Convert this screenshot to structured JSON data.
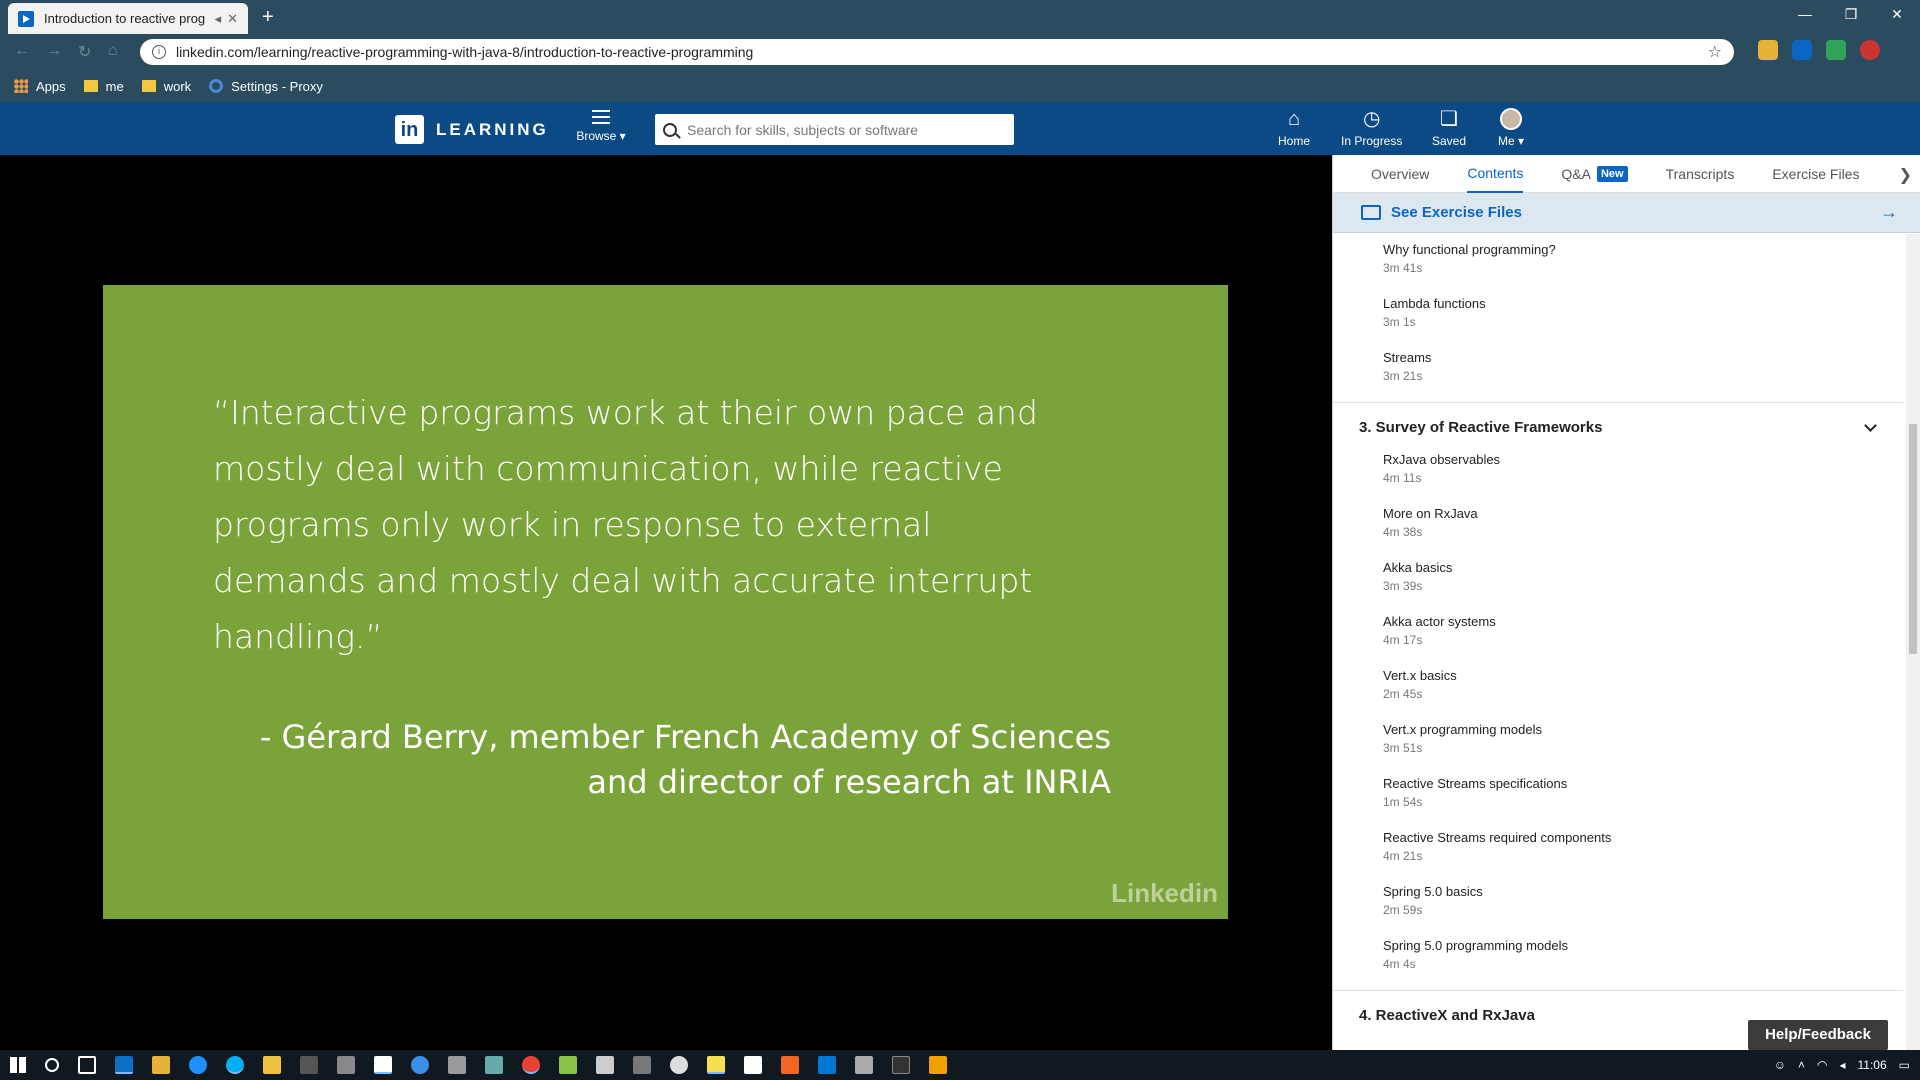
{
  "browser": {
    "tab_title": "Introduction to reactive prog",
    "url": "linkedin.com/learning/reactive-programming-with-java-8/introduction-to-reactive-programming",
    "bookmarks": [
      {
        "label": "Apps",
        "icon": "apps-grid-icon"
      },
      {
        "label": "me",
        "icon": "folder-icon"
      },
      {
        "label": "work",
        "icon": "folder-icon"
      },
      {
        "label": "Settings - Proxy",
        "icon": "gear-icon"
      }
    ]
  },
  "header": {
    "logo_text": "LEARNING",
    "logo_in": "in",
    "browse": "Browse",
    "search_placeholder": "Search for skills, subjects or software",
    "nav": [
      {
        "label": "Home",
        "icon": "home-icon"
      },
      {
        "label": "In Progress",
        "icon": "clock-icon"
      },
      {
        "label": "Saved",
        "icon": "bookmark-icon"
      },
      {
        "label": "Me",
        "icon": "avatar"
      }
    ]
  },
  "slide": {
    "quote": "“Interactive programs work at their own pace and mostly deal with communication, while reactive programs only work in response to external demands and mostly deal with accurate interrupt handling.”",
    "attribution_line1": "- Gérard Berry, member French Academy of Sciences",
    "attribution_line2": "and director of research at INRIA",
    "watermark": "Linkedin",
    "background": "#7aa33a"
  },
  "panel": {
    "tabs": [
      "Overview",
      "Contents",
      "Q&A",
      "Transcripts",
      "Exercise Files"
    ],
    "active_tab": "Contents",
    "qa_badge": "New",
    "exercise_files": "See Exercise Files",
    "items_before": [
      {
        "title": "Why functional programming?",
        "duration": "3m 41s"
      },
      {
        "title": "Lambda functions",
        "duration": "3m 1s"
      },
      {
        "title": "Streams",
        "duration": "3m 21s"
      }
    ],
    "section3": "3. Survey of Reactive Frameworks",
    "section3_items": [
      {
        "title": "RxJava observables",
        "duration": "4m 11s"
      },
      {
        "title": "More on RxJava",
        "duration": "4m 38s"
      },
      {
        "title": "Akka basics",
        "duration": "3m 39s"
      },
      {
        "title": "Akka actor systems",
        "duration": "4m 17s"
      },
      {
        "title": "Vert.x basics",
        "duration": "2m 45s"
      },
      {
        "title": "Vert.x programming models",
        "duration": "3m 51s"
      },
      {
        "title": "Reactive Streams specifications",
        "duration": "1m 54s"
      },
      {
        "title": "Reactive Streams required components",
        "duration": "4m 21s"
      },
      {
        "title": "Spring 5.0 basics",
        "duration": "2m 59s"
      },
      {
        "title": "Spring 5.0 programming models",
        "duration": "4m 4s"
      }
    ],
    "section4": "4. ReactiveX and RxJava",
    "help": "Help/Feedback"
  },
  "taskbar": {
    "time": "11:06"
  }
}
